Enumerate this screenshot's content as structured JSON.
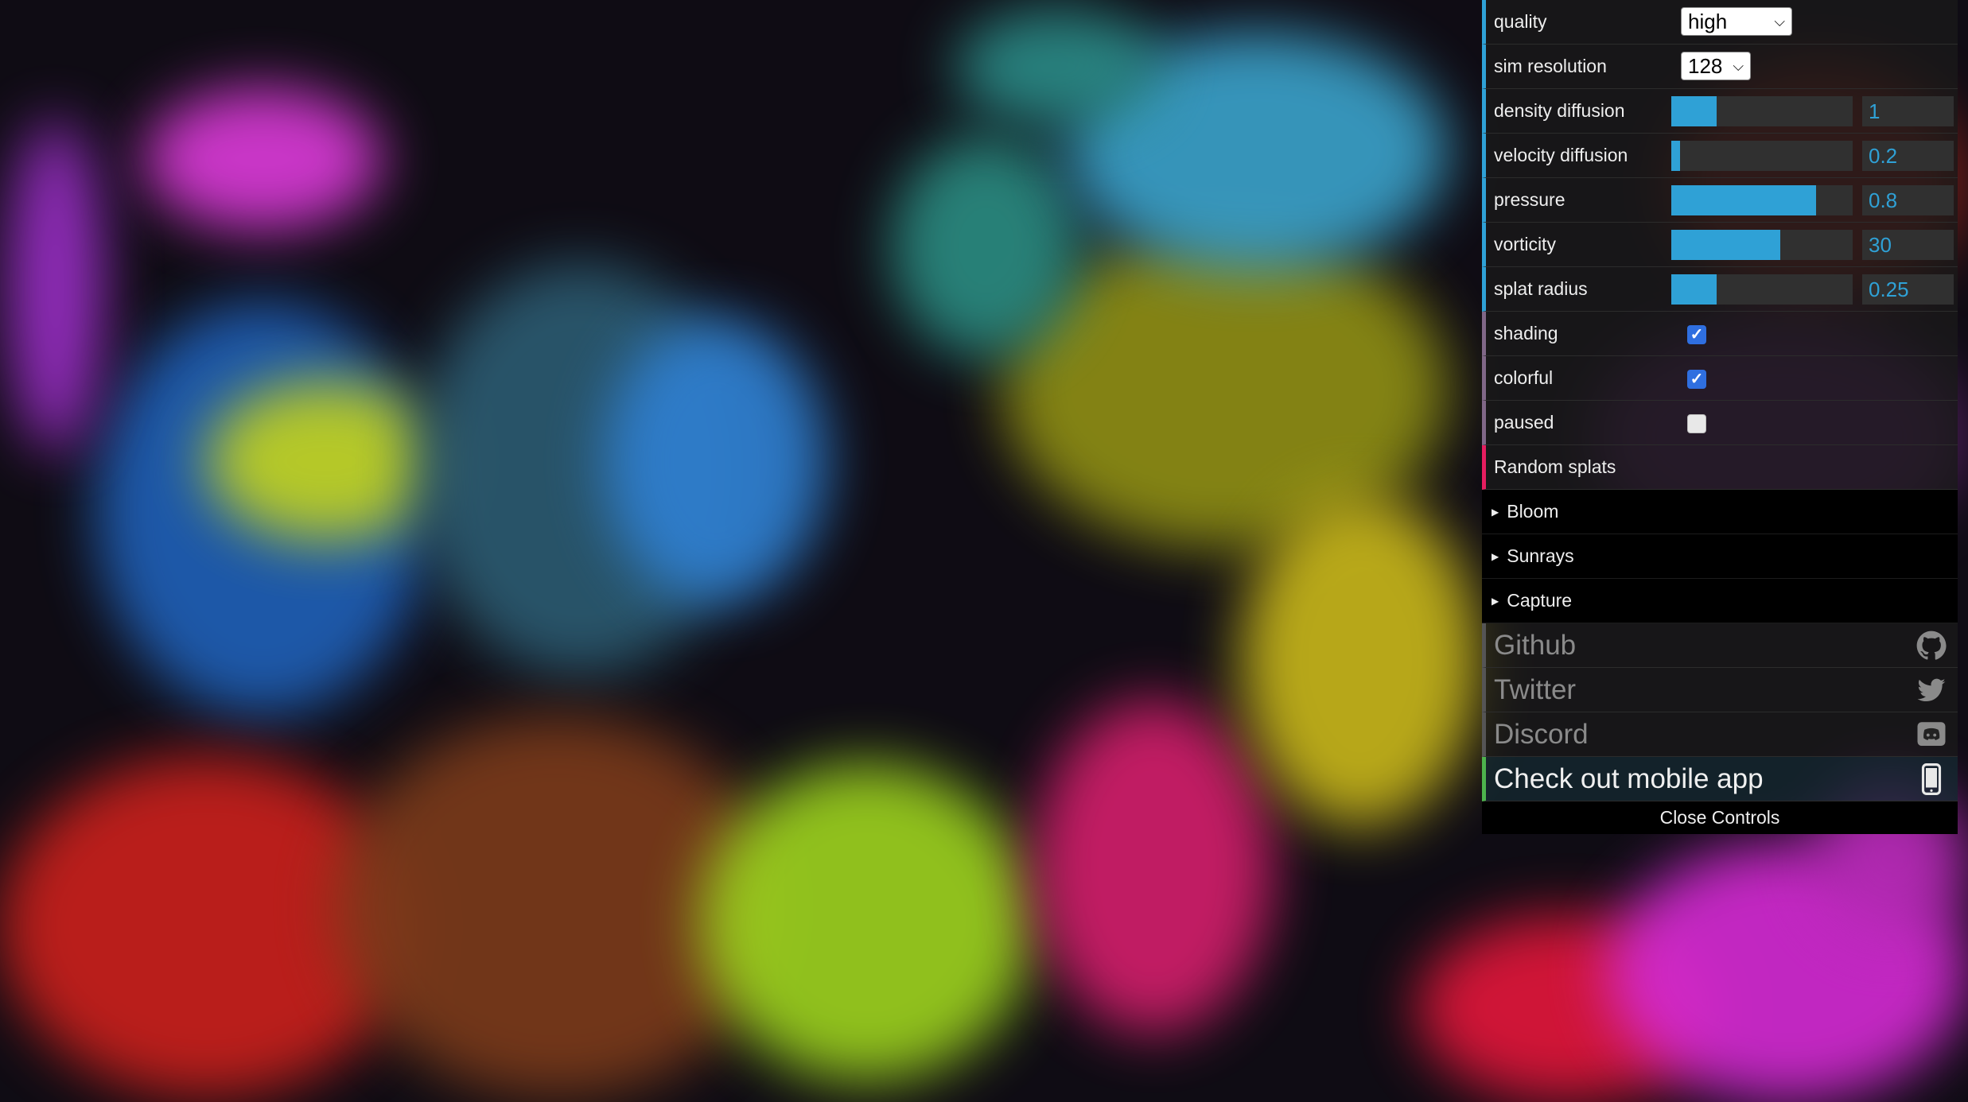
{
  "controls": {
    "quality": {
      "label": "quality",
      "value": "high"
    },
    "sim_resolution": {
      "label": "sim resolution",
      "value": "128"
    },
    "density_diffusion": {
      "label": "density diffusion",
      "value": "1",
      "fill": 0.25
    },
    "velocity_diffusion": {
      "label": "velocity diffusion",
      "value": "0.2",
      "fill": 0.05
    },
    "pressure": {
      "label": "pressure",
      "value": "0.8",
      "fill": 0.8
    },
    "vorticity": {
      "label": "vorticity",
      "value": "30",
      "fill": 0.6
    },
    "splat_radius": {
      "label": "splat radius",
      "value": "0.25",
      "fill": 0.25
    },
    "shading": {
      "label": "shading",
      "checked": true
    },
    "colorful": {
      "label": "colorful",
      "checked": true
    },
    "paused": {
      "label": "paused",
      "checked": false
    },
    "random_splats": {
      "label": "Random splats"
    }
  },
  "folders": [
    "Bloom",
    "Sunrays",
    "Capture"
  ],
  "links": {
    "github": {
      "label": "Github",
      "icon": "github-icon"
    },
    "twitter": {
      "label": "Twitter",
      "icon": "twitter-icon"
    },
    "discord": {
      "label": "Discord",
      "icon": "discord-icon"
    },
    "mobile_app": {
      "label": "Check out mobile app",
      "icon": "phone-icon"
    }
  },
  "close_label": "Close Controls",
  "colors": {
    "accent_number": "#2fa1d6",
    "accent_boolean": "#806787",
    "accent_function": "#e61d5f",
    "accent_mobile": "#4db34d"
  }
}
